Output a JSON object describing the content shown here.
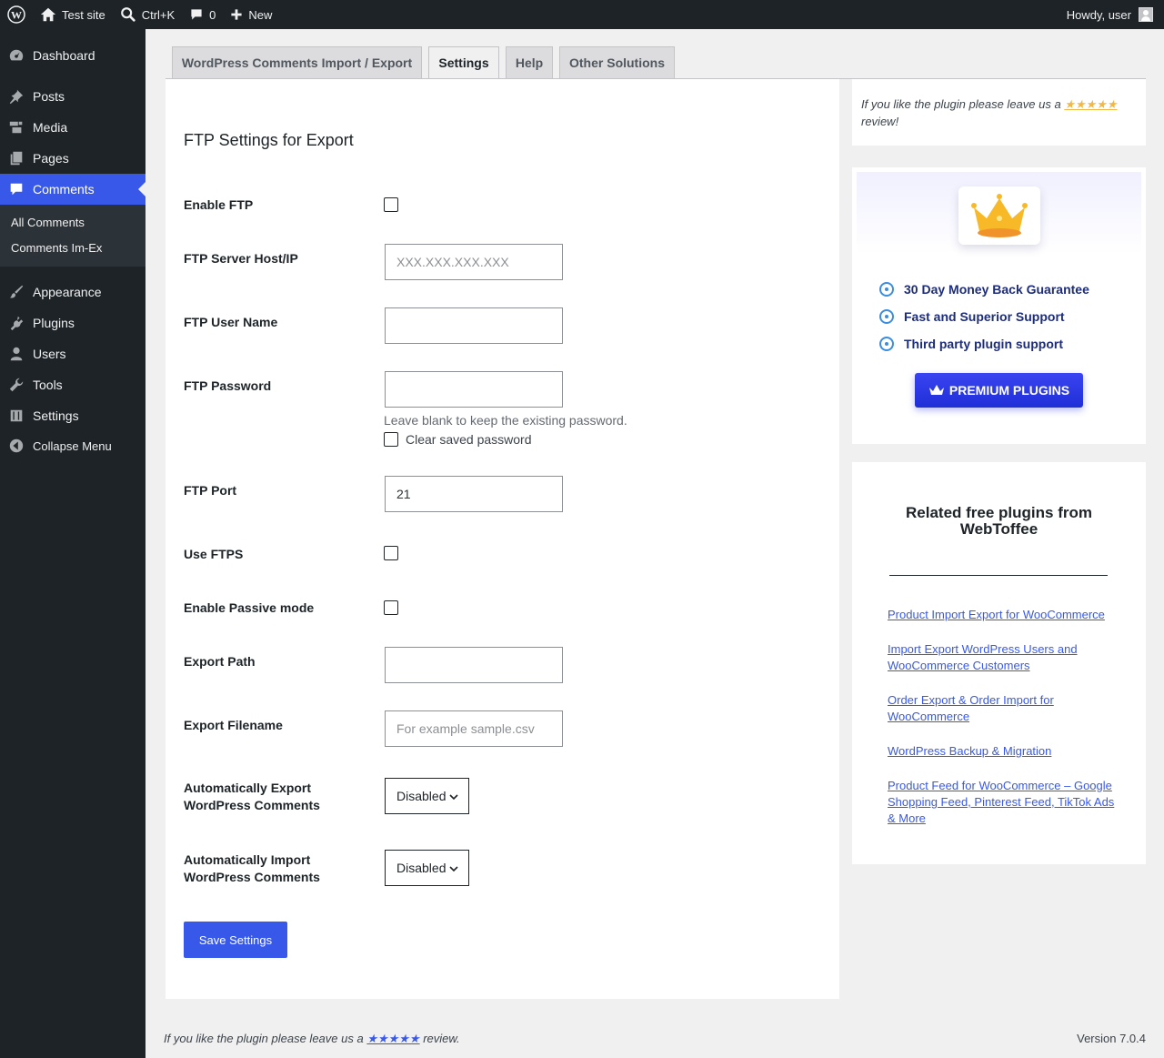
{
  "adminbar": {
    "site_name": "Test site",
    "search_shortcut": "Ctrl+K",
    "comments_count": "0",
    "new_label": "New",
    "greeting": "Howdy, user"
  },
  "sidebar": {
    "items": [
      {
        "label": "Dashboard",
        "icon": "dashboard-icon"
      },
      {
        "label": "Posts",
        "icon": "pin-icon"
      },
      {
        "label": "Media",
        "icon": "media-icon"
      },
      {
        "label": "Pages",
        "icon": "pages-icon"
      },
      {
        "label": "Comments",
        "icon": "comment-icon"
      },
      {
        "label": "Appearance",
        "icon": "brush-icon"
      },
      {
        "label": "Plugins",
        "icon": "plug-icon"
      },
      {
        "label": "Users",
        "icon": "user-icon"
      },
      {
        "label": "Tools",
        "icon": "wrench-icon"
      },
      {
        "label": "Settings",
        "icon": "sliders-icon"
      }
    ],
    "submenu": [
      "All Comments",
      "Comments Im-Ex"
    ],
    "collapse_label": "Collapse Menu"
  },
  "tabs": [
    {
      "label": "WordPress Comments Import / Export",
      "active": false
    },
    {
      "label": "Settings",
      "active": true
    },
    {
      "label": "Help",
      "active": false
    },
    {
      "label": "Other Solutions",
      "active": false
    }
  ],
  "form": {
    "title": "FTP Settings for Export",
    "enable_ftp_label": "Enable FTP",
    "host_label": "FTP Server Host/IP",
    "host_placeholder": "XXX.XXX.XXX.XXX",
    "username_label": "FTP User Name",
    "password_label": "FTP Password",
    "password_hint": "Leave blank to keep the existing password.",
    "clear_password_label": "Clear saved password",
    "port_label": "FTP Port",
    "port_value": "21",
    "ftps_label": "Use FTPS",
    "passive_label": "Enable Passive mode",
    "export_path_label": "Export Path",
    "export_filename_label": "Export Filename",
    "export_filename_placeholder": "For example sample.csv",
    "auto_export_label": "Automatically Export WordPress Comments",
    "auto_export_value": "Disabled",
    "auto_import_label": "Automatically Import WordPress Comments",
    "auto_import_value": "Disabled",
    "save_label": "Save Settings"
  },
  "review_box": {
    "text_before": "If you like the plugin please leave us a ",
    "stars": "★★★★★",
    "text_after": " review!"
  },
  "premium": {
    "features": [
      "30 Day Money Back Guarantee",
      "Fast and Superior Support",
      "Third party plugin support"
    ],
    "button_label": "PREMIUM PLUGINS"
  },
  "related": {
    "title": "Related free plugins from WebToffee",
    "links": [
      "Product Import Export for WooCommerce",
      "Import Export WordPress Users and WooCommerce Customers",
      "Order Export & Order Import for WooCommerce",
      "WordPress Backup & Migration",
      "Product Feed for WooCommerce – Google Shopping Feed, Pinterest Feed, TikTok Ads & More"
    ]
  },
  "footer": {
    "text_before": "If you like the plugin please leave us a ",
    "stars": "★★★★★",
    "text_after": " review.",
    "version": "Version 7.0.4"
  },
  "colors": {
    "accent": "#3858e9",
    "admin_dark": "#1d2327",
    "star_gold": "#f0b849",
    "premium_blue": "#2838ea"
  }
}
